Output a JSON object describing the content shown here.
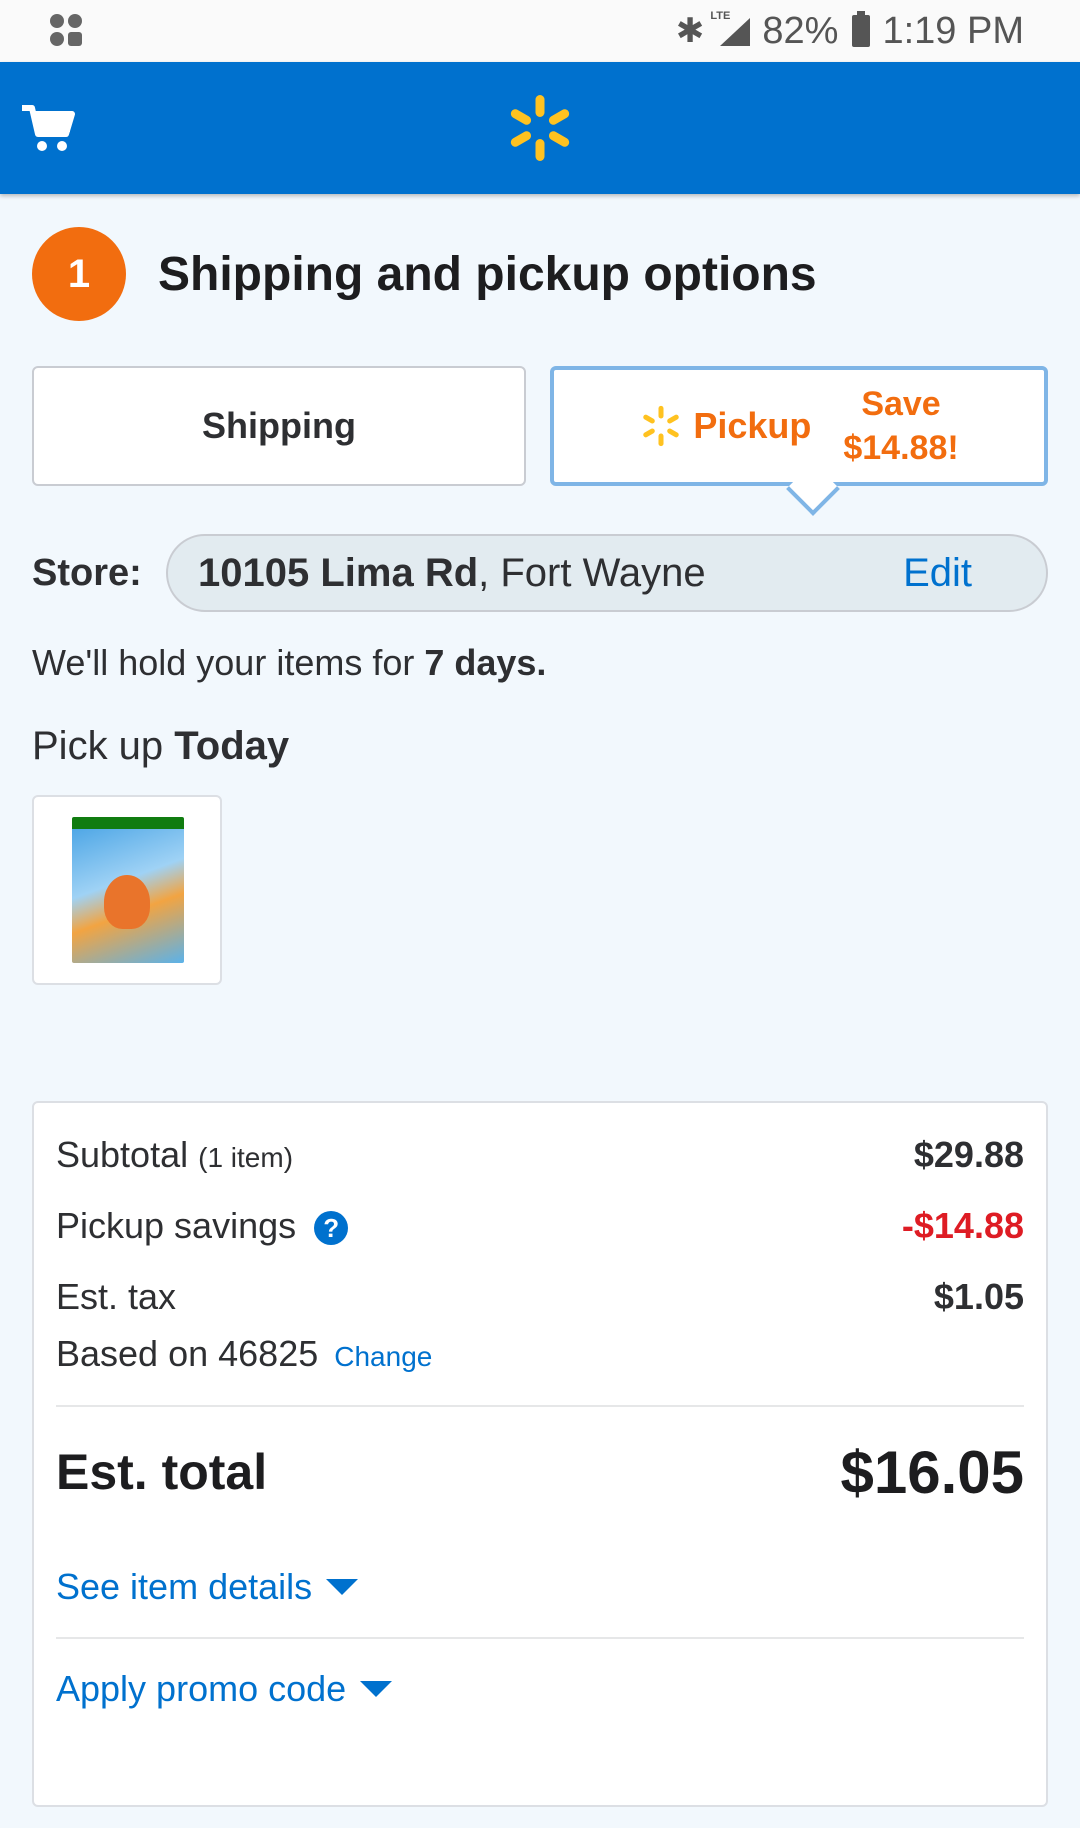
{
  "status_bar": {
    "lte": "LTE",
    "battery": "82%",
    "time": "1:19 PM"
  },
  "header": {
    "cart_icon": "cart-icon",
    "logo_icon": "walmart-spark-icon",
    "brand_color": "#0071ce",
    "spark_color": "#ffc220"
  },
  "step": {
    "number": "1",
    "title": "Shipping and pickup options",
    "badge_color": "#f26d0f"
  },
  "options": {
    "shipping_label": "Shipping",
    "pickup_label": "Pickup",
    "save_line1": "Save",
    "save_line2": "$14.88!",
    "accent_color": "#f26d0f"
  },
  "store": {
    "label": "Store:",
    "address": "10105 Lima Rd",
    "city": ", Fort Wayne",
    "edit_label": "Edit"
  },
  "hold": {
    "prefix": "We'll hold your items for ",
    "days": "7 days."
  },
  "pickup_when": {
    "prefix": "Pick up ",
    "when": "Today"
  },
  "summary": {
    "subtotal_label": "Subtotal",
    "subtotal_count": "(1 item)",
    "subtotal_value": "$29.88",
    "savings_label": "Pickup savings",
    "savings_help": "?",
    "savings_value": "-$14.88",
    "tax_label": "Est. tax",
    "tax_value": "$1.05",
    "tax_based_on": "Based on 46825",
    "tax_change": "Change",
    "total_label": "Est. total",
    "total_value": "$16.05",
    "item_details_link": "See item details",
    "promo_link": "Apply promo code",
    "savings_color": "#de1c24"
  }
}
